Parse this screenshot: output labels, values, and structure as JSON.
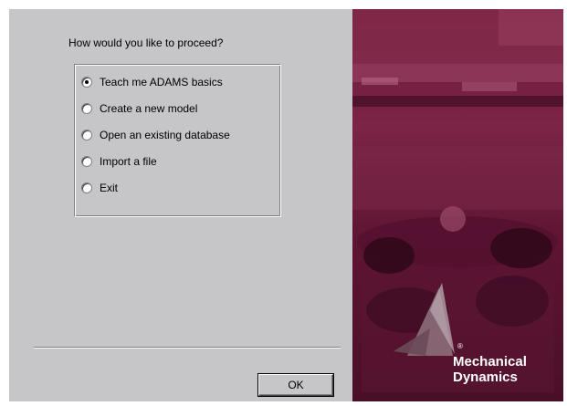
{
  "dialog": {
    "prompt": "How would you like to proceed?",
    "options": [
      {
        "label": "Teach me ADAMS basics",
        "checked": true
      },
      {
        "label": "Create a new model",
        "checked": false
      },
      {
        "label": "Open an existing database",
        "checked": false
      },
      {
        "label": "Import a file",
        "checked": false
      },
      {
        "label": "Exit",
        "checked": false
      }
    ],
    "ok_label": "OK"
  },
  "brand": {
    "line1": "Mechanical",
    "line2": "Dynamics",
    "registered": "®"
  },
  "colors": {
    "panel": "#c6c5c7",
    "art_background": "#6e1a3a"
  }
}
